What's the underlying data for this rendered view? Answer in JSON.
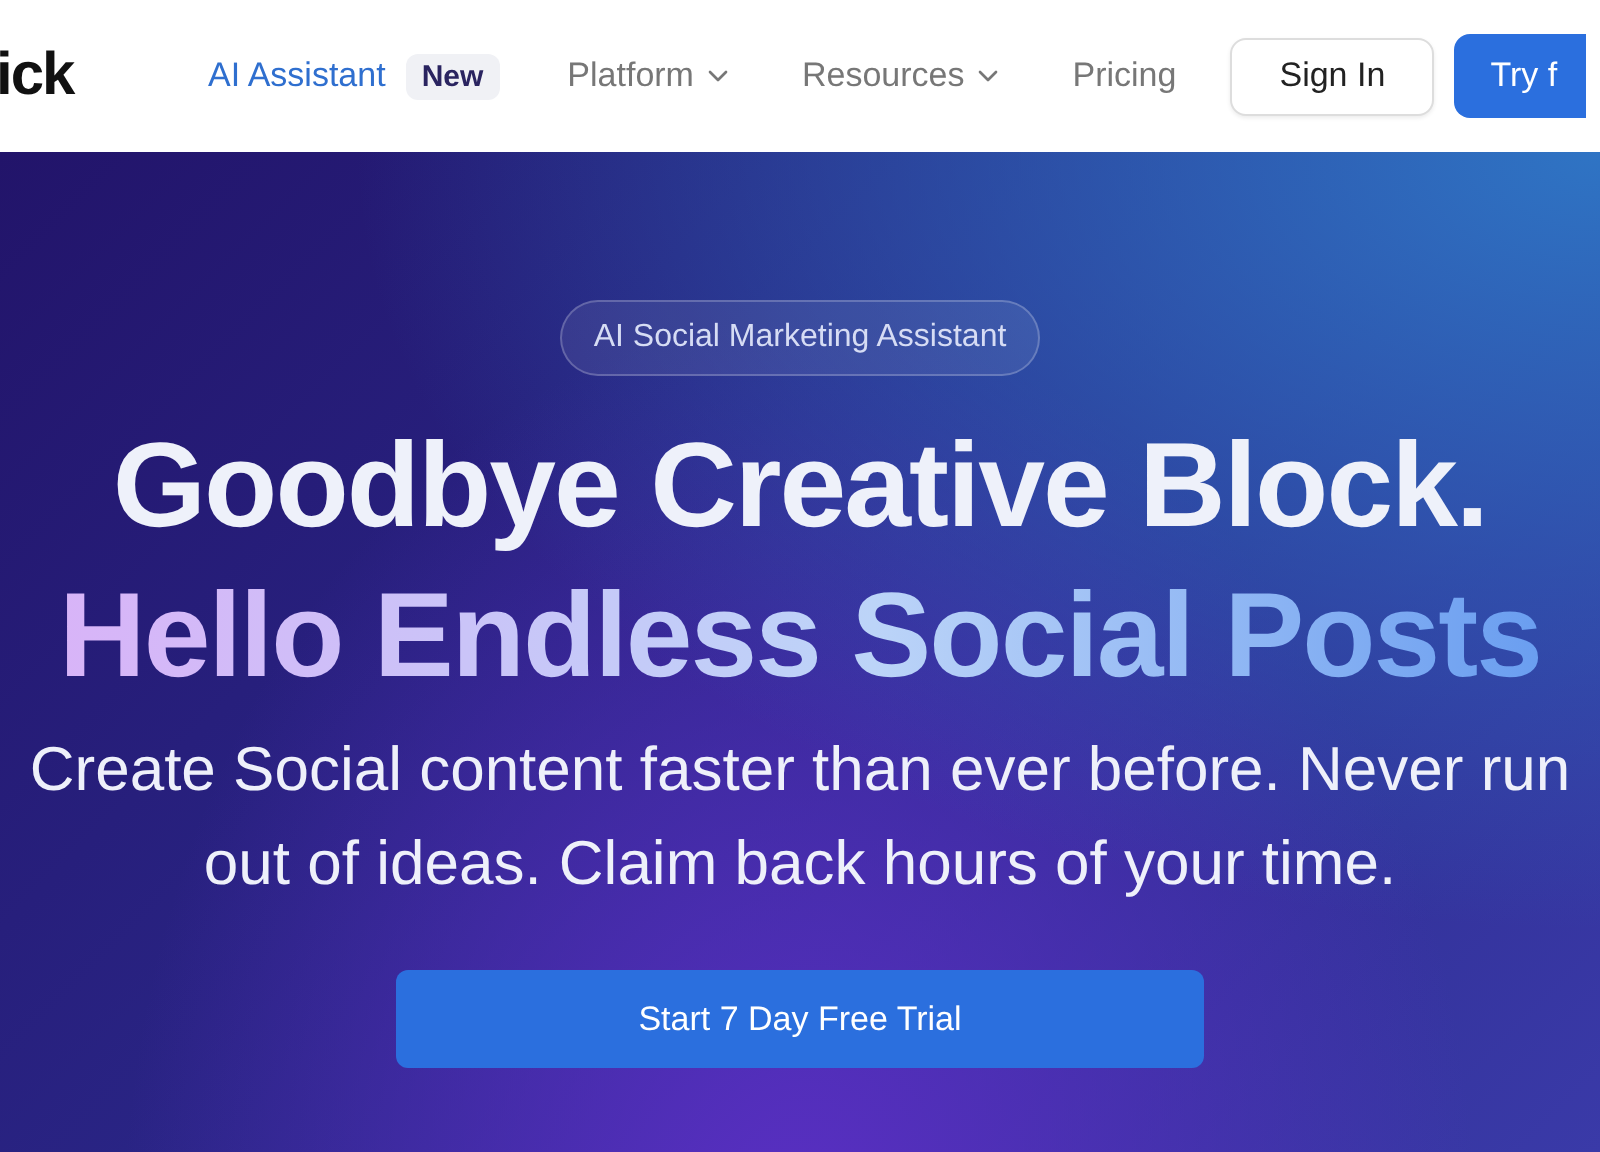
{
  "header": {
    "logo": "ick",
    "nav": [
      {
        "label": "AI Assistant",
        "selected": true,
        "badge": "New",
        "dropdown": false
      },
      {
        "label": "Platform",
        "selected": false,
        "dropdown": true
      },
      {
        "label": "Resources",
        "selected": false,
        "dropdown": true
      },
      {
        "label": "Pricing",
        "selected": false,
        "dropdown": false
      }
    ],
    "sign_in": "Sign In",
    "try_button": "Try f"
  },
  "hero": {
    "tag": "AI Social Marketing Assistant",
    "headline": "Goodbye Creative Block.",
    "headline_2": "Hello Endless Social Posts",
    "subtitle": "Create Social content faster than ever before. Never run out of ideas. Claim back hours of your time.",
    "cta": "Start 7 Day Free Trial"
  }
}
